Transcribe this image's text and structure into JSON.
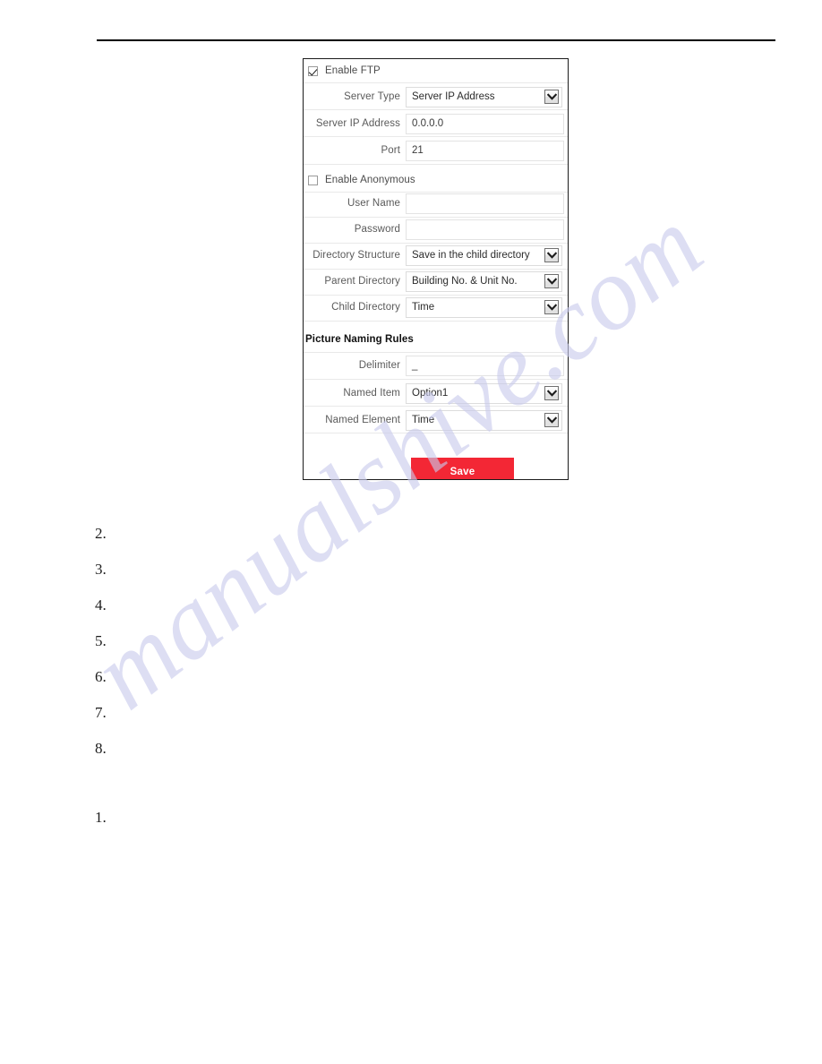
{
  "page": {
    "watermark": "manualshive.com",
    "header_rule": true
  },
  "ftp_panel": {
    "enable_ftp": {
      "label": "Enable FTP",
      "checked": true
    },
    "enable_anonymous": {
      "label": "Enable Anonymous",
      "checked": false
    },
    "fields": [
      {
        "label": "Server Type",
        "value": "Server IP Address",
        "control": "select"
      },
      {
        "label": "Server IP Address",
        "value": "0.0.0.0",
        "control": "text"
      },
      {
        "label": "Port",
        "value": "21",
        "control": "text"
      },
      {
        "label": "User Name",
        "value": "",
        "control": "text"
      },
      {
        "label": "Password",
        "value": "",
        "control": "text"
      },
      {
        "label": "Directory Structure",
        "value": "Save in the child directory",
        "control": "select"
      },
      {
        "label": "Parent Directory",
        "value": "Building No. & Unit No.",
        "control": "select"
      },
      {
        "label": "Child Directory",
        "value": "Time",
        "control": "select"
      }
    ],
    "section_heading": "Picture Naming Rules",
    "naming_fields": [
      {
        "label": "Delimiter",
        "value": "_",
        "control": "text"
      },
      {
        "label": "Named Item",
        "value": "Option1",
        "control": "select"
      },
      {
        "label": "Named Element",
        "value": "Time",
        "control": "select"
      }
    ],
    "save_label": "Save",
    "save_color": "#f32735"
  },
  "list_items": [
    {
      "marker": "2."
    },
    {
      "marker": "3."
    },
    {
      "marker": "4."
    },
    {
      "marker": "5."
    },
    {
      "marker": "6."
    },
    {
      "marker": "7."
    },
    {
      "marker": "8."
    },
    {
      "marker": "1."
    }
  ]
}
